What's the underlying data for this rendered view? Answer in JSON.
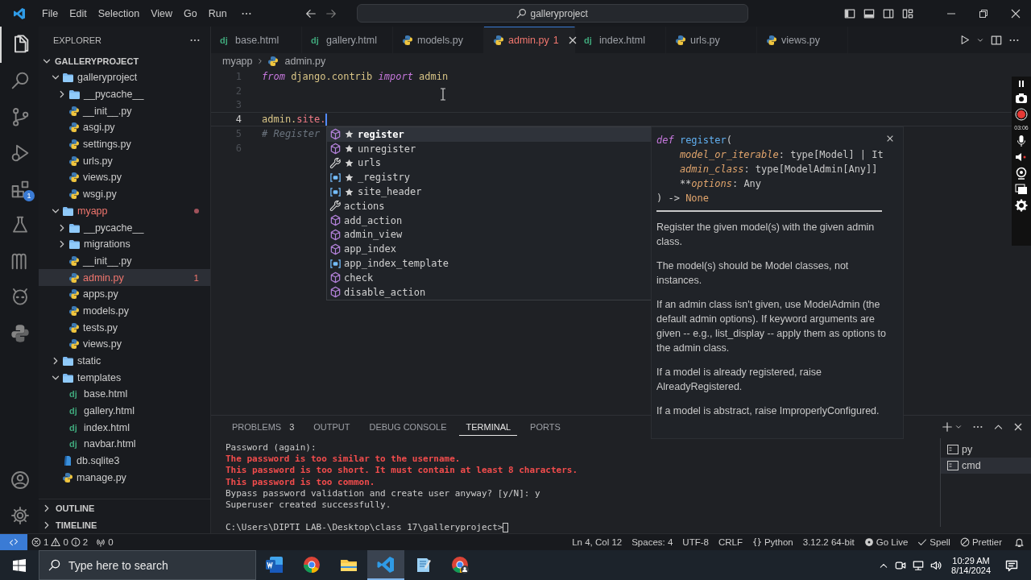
{
  "title_bar": {
    "menu": [
      "File",
      "Edit",
      "Selection",
      "View",
      "Go",
      "Run"
    ],
    "search": "galleryproject"
  },
  "activity_bar": {
    "items": [
      {
        "selected": true
      },
      {
        "selected": false
      },
      {
        "selected": false
      },
      {
        "selected": false
      },
      {
        "selected": false,
        "badge": "1"
      },
      {
        "selected": false
      },
      {
        "selected": false
      },
      {
        "selected": false
      },
      {
        "selected": false
      }
    ]
  },
  "sidebar": {
    "title": "EXPLORER",
    "root": {
      "label": "GALLERYPROJECT",
      "expanded": true,
      "children": [
        {
          "label": "galleryproject",
          "kind": "folder",
          "expanded": true,
          "selected": false,
          "problem": false,
          "children": [
            {
              "label": "__pycache__",
              "kind": "folder",
              "expanded": false,
              "selected": false,
              "problem": false
            },
            {
              "label": "__init__.py",
              "kind": "python",
              "selected": false,
              "problem": false
            },
            {
              "label": "asgi.py",
              "kind": "python",
              "selected": false,
              "problem": false
            },
            {
              "label": "settings.py",
              "kind": "python",
              "selected": false,
              "problem": false
            },
            {
              "label": "urls.py",
              "kind": "python",
              "selected": false,
              "problem": false
            },
            {
              "label": "views.py",
              "kind": "python",
              "selected": false,
              "problem": false
            },
            {
              "label": "wsgi.py",
              "kind": "python",
              "selected": false,
              "problem": false
            }
          ]
        },
        {
          "label": "myapp",
          "kind": "folder",
          "expanded": true,
          "selected": false,
          "problem": true,
          "children": [
            {
              "label": "__pycache__",
              "kind": "folder",
              "expanded": false,
              "selected": false,
              "problem": false
            },
            {
              "label": "migrations",
              "kind": "folder",
              "expanded": false,
              "selected": false,
              "problem": false
            },
            {
              "label": "__init__.py",
              "kind": "python",
              "selected": false,
              "problem": false
            },
            {
              "label": "admin.py",
              "kind": "python",
              "selected": true,
              "problem": true,
              "badge": "1"
            },
            {
              "label": "apps.py",
              "kind": "python",
              "selected": false,
              "problem": false
            },
            {
              "label": "models.py",
              "kind": "python",
              "selected": false,
              "problem": false
            },
            {
              "label": "tests.py",
              "kind": "python",
              "selected": false,
              "problem": false
            },
            {
              "label": "views.py",
              "kind": "python",
              "selected": false,
              "problem": false
            }
          ]
        },
        {
          "label": "static",
          "kind": "folder",
          "expanded": false,
          "selected": false,
          "problem": false
        },
        {
          "label": "templates",
          "kind": "folder",
          "expanded": true,
          "selected": false,
          "problem": false,
          "children": [
            {
              "label": "base.html",
              "kind": "django",
              "icon_text": "dj",
              "selected": false,
              "problem": false
            },
            {
              "label": "gallery.html",
              "kind": "django",
              "icon_text": "dj",
              "selected": false,
              "problem": false
            },
            {
              "label": "index.html",
              "kind": "django",
              "icon_text": "dj",
              "selected": false,
              "problem": false
            },
            {
              "label": "navbar.html",
              "kind": "django",
              "icon_text": "dj",
              "selected": false,
              "problem": false
            }
          ]
        },
        {
          "label": "db.sqlite3",
          "kind": "sqlite",
          "selected": false,
          "problem": false
        },
        {
          "label": "manage.py",
          "kind": "python",
          "selected": false,
          "problem": false
        }
      ]
    },
    "sections": [
      {
        "label": "OUTLINE",
        "expanded": false
      },
      {
        "label": "TIMELINE",
        "expanded": false
      }
    ]
  },
  "tabs": [
    {
      "label": "base.html",
      "kind": "django",
      "icon_text": "dj",
      "selected": false,
      "problem": false
    },
    {
      "label": "gallery.html",
      "kind": "django",
      "icon_text": "dj",
      "selected": false,
      "problem": false
    },
    {
      "label": "models.py",
      "kind": "python",
      "selected": false,
      "problem": false
    },
    {
      "label": "admin.py",
      "kind": "python",
      "selected": true,
      "problem": true,
      "badge": "1"
    },
    {
      "label": "index.html",
      "kind": "django",
      "icon_text": "dj",
      "selected": false,
      "problem": false
    },
    {
      "label": "urls.py",
      "kind": "python",
      "selected": false,
      "problem": false
    },
    {
      "label": "views.py",
      "kind": "python",
      "selected": false,
      "problem": false
    }
  ],
  "breadcrumb": [
    {
      "label": "myapp",
      "kind": "folder"
    },
    {
      "label": "admin.py",
      "kind": "python"
    }
  ],
  "editor": {
    "lines": [
      {
        "number": "1",
        "current": false,
        "tokens": [
          {
            "text": "from",
            "kind": "keyword"
          },
          {
            "text": " django.contrib",
            "kind": "module"
          },
          {
            "text": " import",
            "kind": "keyword"
          },
          {
            "text": " admin",
            "kind": "module"
          }
        ]
      },
      {
        "number": "2",
        "current": false
      },
      {
        "number": "3",
        "current": false
      },
      {
        "number": "4",
        "current": true,
        "tokens": [
          {
            "text": "admin.",
            "kind": "module"
          },
          {
            "text": "site.",
            "kind": "property"
          }
        ]
      },
      {
        "number": "5",
        "current": false,
        "tokens": [
          {
            "text": "# Register",
            "kind": "comment"
          }
        ]
      },
      {
        "number": "6",
        "current": false
      }
    ]
  },
  "suggest": {
    "items": [
      {
        "label": "register",
        "starred": true,
        "kind": "method",
        "selected": true
      },
      {
        "label": "unregister",
        "starred": true,
        "kind": "method",
        "selected": false
      },
      {
        "label": "urls",
        "starred": true,
        "kind": "property",
        "selected": false
      },
      {
        "label": "_registry",
        "starred": true,
        "kind": "field",
        "selected": false
      },
      {
        "label": "site_header",
        "starred": true,
        "kind": "field",
        "selected": false
      },
      {
        "label": "actions",
        "starred": false,
        "kind": "property",
        "selected": false
      },
      {
        "label": "add_action",
        "starred": false,
        "kind": "method",
        "selected": false
      },
      {
        "label": "admin_view",
        "starred": false,
        "kind": "method",
        "selected": false
      },
      {
        "label": "app_index",
        "starred": false,
        "kind": "method",
        "selected": false
      },
      {
        "label": "app_index_template",
        "starred": false,
        "kind": "field",
        "selected": false
      },
      {
        "label": "check",
        "starred": false,
        "kind": "method",
        "selected": false
      },
      {
        "label": "disable_action",
        "starred": false,
        "kind": "method",
        "selected": false
      }
    ]
  },
  "docs": {
    "signature": [
      [
        {
          "text": "def",
          "kind": "keyword"
        },
        {
          "text": " register",
          "kind": "function"
        },
        {
          "text": "(",
          "kind": "plain"
        }
      ],
      [
        {
          "text": "    model_or_iterable",
          "kind": "param"
        },
        {
          "text": ": type[Model] | It",
          "kind": "plain"
        }
      ],
      [
        {
          "text": "    admin_class",
          "kind": "param"
        },
        {
          "text": ": type[ModelAdmin[Any]]",
          "kind": "plain"
        }
      ],
      [
        {
          "text": "    **",
          "kind": "plain"
        },
        {
          "text": "options",
          "kind": "param"
        },
        {
          "text": ": Any",
          "kind": "plain"
        }
      ],
      [
        {
          "text": ") -> ",
          "kind": "plain"
        },
        {
          "text": "None",
          "kind": "builtin"
        }
      ]
    ],
    "paragraphs": [
      "Register the given model(s) with the given admin class.",
      "The model(s) should be Model classes, not instances.",
      "If an admin class isn't given, use ModelAdmin (the default admin options). If keyword arguments are given -- e.g., list_display -- apply them as options to the admin class.",
      "If a model is already registered, raise AlreadyRegistered.",
      "If a model is abstract, raise ImproperlyConfigured."
    ]
  },
  "panel": {
    "tabs": [
      {
        "label": "PROBLEMS",
        "badge": "3",
        "selected": false
      },
      {
        "label": "OUTPUT",
        "selected": false
      },
      {
        "label": "DEBUG CONSOLE",
        "selected": false
      },
      {
        "label": "TERMINAL",
        "selected": true
      },
      {
        "label": "PORTS",
        "selected": false
      }
    ],
    "terminal": [
      {
        "text": "Password (again):",
        "kind": "normal"
      },
      {
        "text": "The password is too similar to the username.",
        "kind": "error"
      },
      {
        "text": "This password is too short. It must contain at least 8 characters.",
        "kind": "error"
      },
      {
        "text": "This password is too common.",
        "kind": "error"
      },
      {
        "text": "Bypass password validation and create user anyway? [y/N]: y",
        "kind": "normal"
      },
      {
        "text": "Superuser created successfully.",
        "kind": "normal"
      },
      {
        "text": "C:\\Users\\DIPTI LAB-\\Desktop\\class 17\\galleryproject>",
        "kind": "prompt"
      }
    ],
    "sessions": [
      {
        "label": "py",
        "selected": false
      },
      {
        "label": "cmd",
        "selected": true
      }
    ]
  },
  "status_bar": {
    "errors": "1",
    "warnings": "0",
    "infos": "2",
    "ports": "0",
    "right": [
      {
        "label": "Ln 4, Col 12",
        "kind": "plain"
      },
      {
        "label": "Spaces: 4",
        "kind": "plain"
      },
      {
        "label": "UTF-8",
        "kind": "plain"
      },
      {
        "label": "CRLF",
        "kind": "plain"
      },
      {
        "label": "Python",
        "kind": "language"
      },
      {
        "label": "3.12.2 64-bit",
        "kind": "plain"
      },
      {
        "label": "Go Live",
        "kind": "live"
      },
      {
        "label": "Spell",
        "kind": "check"
      },
      {
        "label": "Prettier",
        "kind": "prettier"
      }
    ]
  },
  "recorder": {
    "time": "03:06"
  },
  "taskbar": {
    "search_placeholder": "Type here to search",
    "apps": [
      {
        "selected": false
      },
      {
        "selected": false
      },
      {
        "selected": false
      },
      {
        "selected": true
      },
      {
        "selected": false
      },
      {
        "selected": false
      }
    ],
    "time": "10:29 AM",
    "date": "8/14/2024"
  }
}
